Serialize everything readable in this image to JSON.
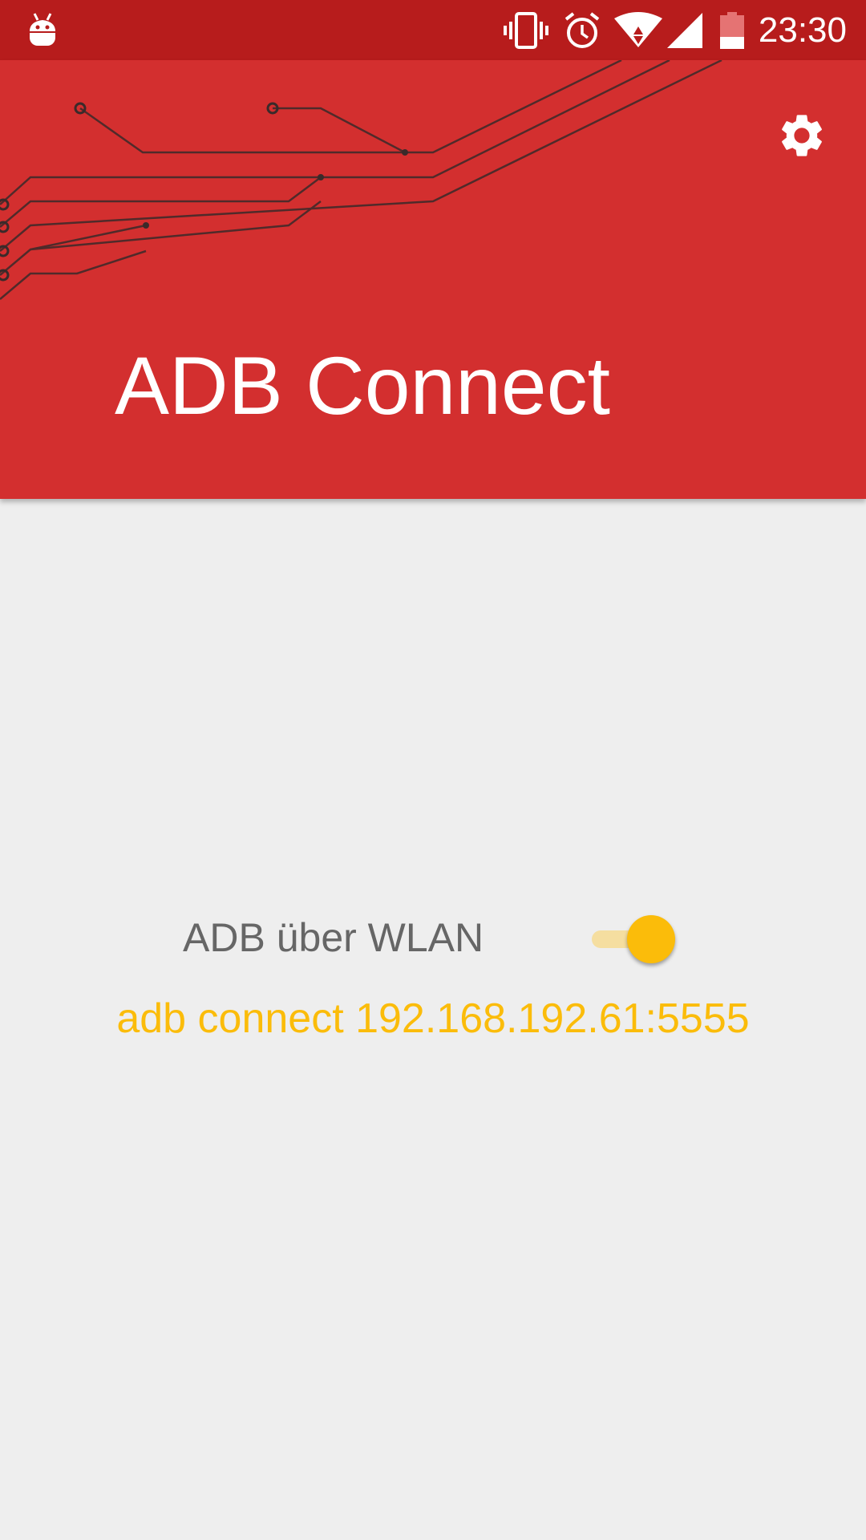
{
  "status_bar": {
    "time": "23:30",
    "icons": [
      "android-notification-icon",
      "vibrate-icon",
      "alarm-icon",
      "wifi-icon",
      "cell-signal-icon",
      "battery-low-icon"
    ]
  },
  "app_bar": {
    "title": "ADB Connect",
    "settings_icon": "gear-icon",
    "background_color": "#d32f2f",
    "status_bar_color": "#b71c1c"
  },
  "main": {
    "adb_toggle_label": "ADB über WLAN",
    "adb_toggle_on": true,
    "connect_command": "adb connect 192.168.192.61:5555",
    "accent_color": "#fbbc0a"
  }
}
